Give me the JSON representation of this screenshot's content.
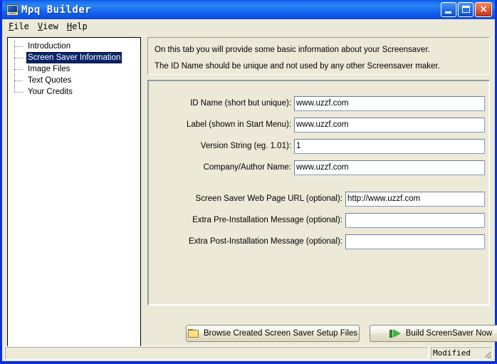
{
  "window": {
    "title": "Mpq Builder",
    "app_icon": "monitor-icon",
    "controls": {
      "minimize": "minimize-icon",
      "maximize": "maximize-icon",
      "close": "×"
    }
  },
  "menubar": {
    "items": [
      {
        "label": "File",
        "accel": "F"
      },
      {
        "label": "View",
        "accel": "V"
      },
      {
        "label": "Help",
        "accel": "H"
      }
    ]
  },
  "tree": {
    "items": [
      {
        "label": "Introduction",
        "selected": false
      },
      {
        "label": "Screen Saver Information",
        "selected": true
      },
      {
        "label": "Image Files",
        "selected": false
      },
      {
        "label": "Text Quotes",
        "selected": false
      },
      {
        "label": "Your Credits",
        "selected": false
      }
    ]
  },
  "info": {
    "line1": "On this tab you will provide some basic information about your Screensaver.",
    "line2": "The ID Name should be unique and not used by any other Screensaver maker."
  },
  "form": {
    "fields": [
      {
        "label": "ID Name (short but unique):",
        "value": "www.uzzf.com",
        "placeholder": ""
      },
      {
        "label": "Label (shown in Start Menu):",
        "value": "www.uzzf.com",
        "placeholder": ""
      },
      {
        "label": "Version String (eg. 1.01):",
        "value": "1",
        "placeholder": ""
      },
      {
        "label": "Company/Author Name:",
        "value": "www.uzzf.com",
        "placeholder": ""
      },
      {
        "label": "Screen Saver Web Page URL (optional):",
        "value": "http://www.uzzf.com",
        "placeholder": ""
      },
      {
        "label": "Extra Pre-Installation Message (optional):",
        "value": "",
        "placeholder": ""
      },
      {
        "label": "Extra Post-Installation Message (optional):",
        "value": "",
        "placeholder": ""
      }
    ]
  },
  "buttons": {
    "browse": {
      "label": "Browse Created Screen Saver Setup Files",
      "icon": "folder-icon"
    },
    "build": {
      "label": "Build ScreenSaver Now",
      "icon": "green-arrow-icon"
    }
  },
  "statusbar": {
    "main": "",
    "right": "Modified"
  },
  "colors": {
    "title_blue": "#0a52dd",
    "face": "#ece9d8",
    "selection": "#0a246a",
    "field_border": "#7f9db9",
    "close_red": "#c0321a",
    "folder_yellow": "#fbe08a",
    "arrow_green": "#3fb13f"
  }
}
